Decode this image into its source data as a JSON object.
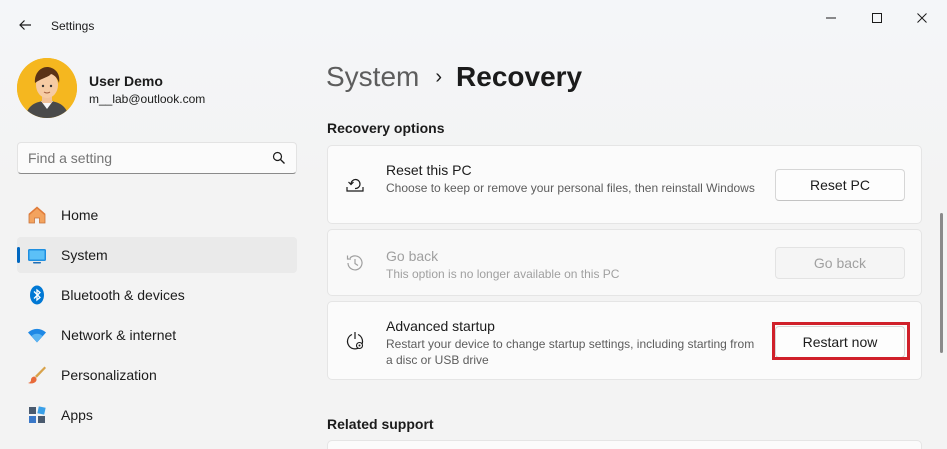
{
  "window": {
    "app_title": "Settings",
    "controls": [
      "minimize",
      "maximize",
      "close"
    ]
  },
  "profile": {
    "name": "User Demo",
    "email": "m__lab@outlook.com"
  },
  "search": {
    "placeholder": "Find a setting",
    "icon": "search-icon"
  },
  "nav": {
    "items": [
      {
        "label": "Home",
        "icon": "home-icon",
        "active": false
      },
      {
        "label": "System",
        "icon": "system-icon",
        "active": true
      },
      {
        "label": "Bluetooth & devices",
        "icon": "bluetooth-icon",
        "active": false
      },
      {
        "label": "Network & internet",
        "icon": "network-icon",
        "active": false
      },
      {
        "label": "Personalization",
        "icon": "personalization-icon",
        "active": false
      },
      {
        "label": "Apps",
        "icon": "apps-icon",
        "active": false
      }
    ]
  },
  "header": {
    "parent": "System",
    "separator": "›",
    "current": "Recovery"
  },
  "recovery_options": {
    "section_title": "Recovery options",
    "cards": [
      {
        "title": "Reset this PC",
        "description": "Choose to keep or remove your personal files, then reinstall Windows",
        "button": "Reset PC",
        "icon": "reset-pc-icon",
        "enabled": true
      },
      {
        "title": "Go back",
        "description": "This option is no longer available on this PC",
        "button": "Go back",
        "icon": "history-icon",
        "enabled": false
      },
      {
        "title": "Advanced startup",
        "description": "Restart your device to change startup settings, including starting from a disc or USB drive",
        "button": "Restart now",
        "icon": "advanced-startup-icon",
        "enabled": true,
        "highlighted": true
      }
    ]
  },
  "related_support": {
    "section_title": "Related support"
  },
  "colors": {
    "accent": "#0067c0",
    "highlight": "#d0202a"
  }
}
